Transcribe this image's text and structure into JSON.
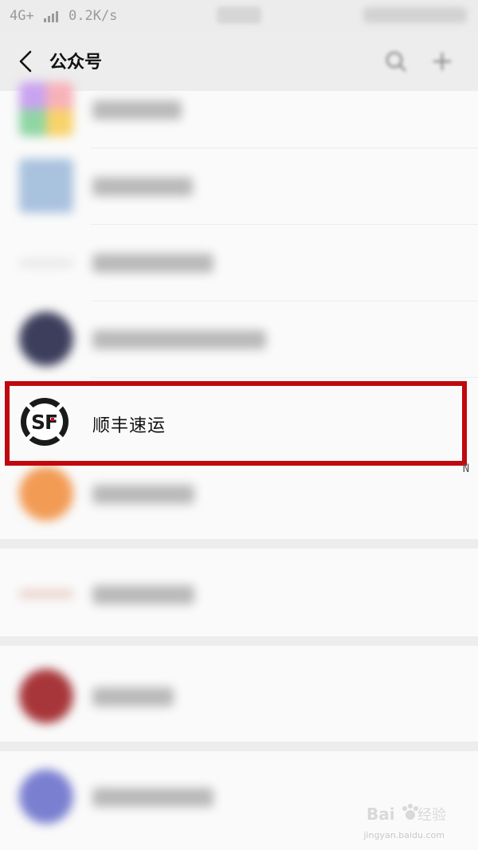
{
  "status_bar": {
    "network": "4G+",
    "speed": "0.2K/s"
  },
  "header": {
    "back_icon": "chevron-left-icon",
    "title": "公众号",
    "search_icon": "search-icon",
    "add_icon": "plus-icon"
  },
  "accounts": [
    {
      "label": "",
      "avatar_color": "#e9a38a",
      "blurred": true
    },
    {
      "label": "",
      "avatar_color": "#a9c2de",
      "blurred": true
    },
    {
      "label": "",
      "avatar_color": "#d7d7d7",
      "blurred": true
    },
    {
      "label": "",
      "avatar_color": "#3c3e5c",
      "blurred": true
    },
    {
      "label": "顺丰速运",
      "avatar_color": "#ffffff",
      "blurred": false,
      "highlighted": true
    },
    {
      "label": "",
      "avatar_color": "#f29b55",
      "blurred": true
    },
    {
      "label": "",
      "avatar_color": "#e8cfc6",
      "blurred": true
    },
    {
      "label": "",
      "avatar_color": "#a7363a",
      "blurred": true
    },
    {
      "label": "",
      "avatar_color": "#7a7fd0",
      "blurred": true
    }
  ],
  "index_bar": {
    "letters": [
      "",
      "",
      "",
      "",
      "",
      "",
      "",
      "",
      "",
      "",
      "",
      "",
      "",
      "N",
      "",
      "",
      "",
      "",
      "",
      "",
      "",
      "",
      "",
      "",
      "",
      ""
    ]
  },
  "highlight_color": "#c0090e",
  "watermark": {
    "text": "Baidu经验",
    "url_text": "jingyan.baidu.com"
  }
}
